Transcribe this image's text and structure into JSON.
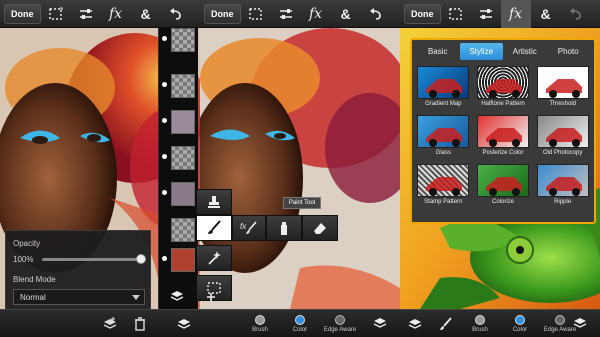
{
  "toolbar": {
    "done_label": "Done",
    "fx_label": "fx",
    "amp_label": "&"
  },
  "layers_panel": {
    "opacity_label": "Opacity",
    "opacity_value": "100%",
    "opacity_level": 1.0,
    "blend_label": "Blend Mode",
    "blend_value": "Normal"
  },
  "tool_menu": {
    "tooltip": "Paint Tool"
  },
  "bottom_tools": {
    "brush": "Brush",
    "color": "Color",
    "edge": "Edge Aware"
  },
  "stylize": {
    "tabs": [
      "Basic",
      "Stylize",
      "Artistic",
      "Photo"
    ],
    "active_tab": "Stylize",
    "effects": [
      "Gradient Map",
      "Halftone Pattern",
      "Threshold",
      "Glass",
      "Posterize Color",
      "Old Photocopy",
      "Stamp Pattern",
      "Colorize",
      "Ripple"
    ]
  },
  "colors": {
    "accent": "#f0a800",
    "tab_active": "#3a9ee8",
    "color_dot": "#2f8fe0"
  }
}
